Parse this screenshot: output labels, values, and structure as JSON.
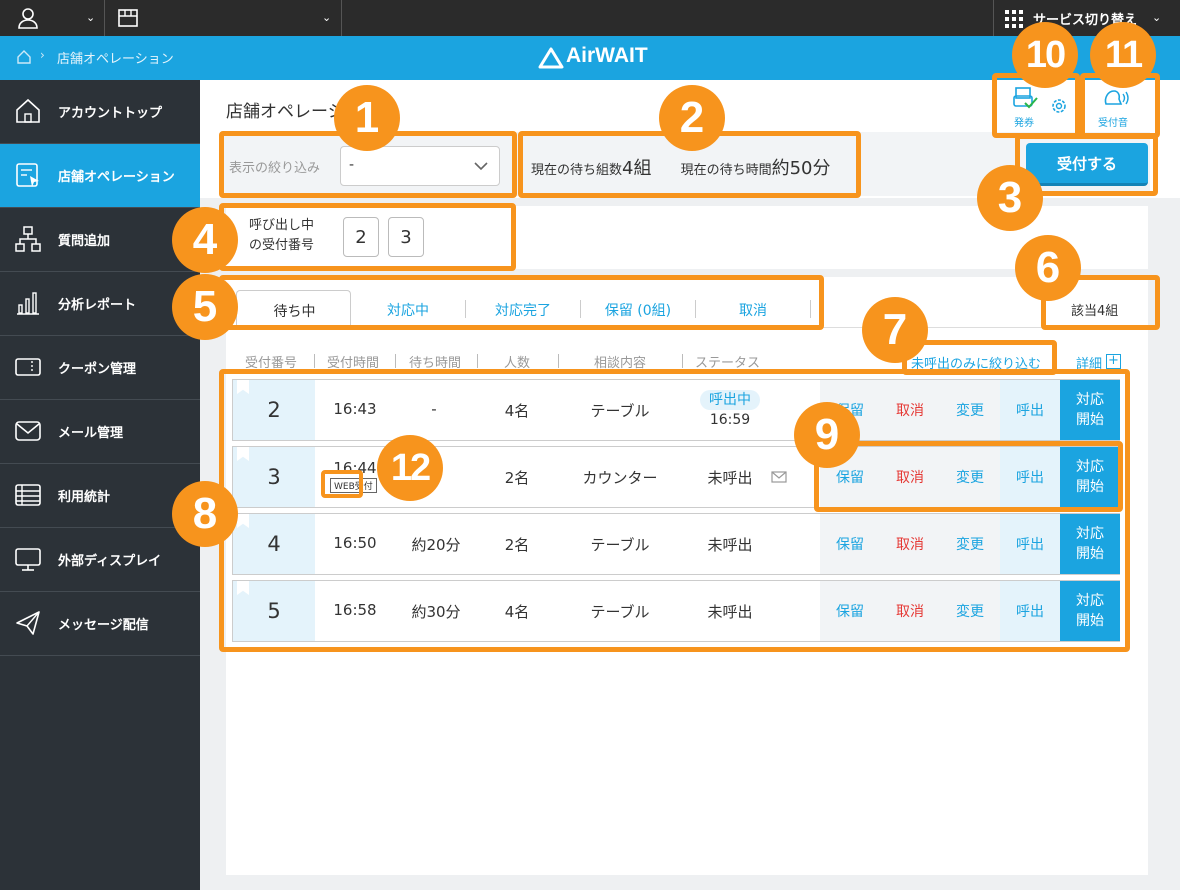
{
  "topbar": {
    "service_switch": "サービス切り替え"
  },
  "header": {
    "breadcrumb": "店舗オペレーション",
    "logo": "AirWAIT"
  },
  "sidebar": {
    "items": [
      {
        "label": "アカウントトップ",
        "icon": "home-icon"
      },
      {
        "label": "店舗オペレーション",
        "icon": "store-operation-icon"
      },
      {
        "label": "質問追加",
        "icon": "hierarchy-icon"
      },
      {
        "label": "分析レポート",
        "icon": "bar-chart-icon"
      },
      {
        "label": "クーポン管理",
        "icon": "coupon-icon"
      },
      {
        "label": "メール管理",
        "icon": "mail-icon"
      },
      {
        "label": "利用統計",
        "icon": "table-icon"
      },
      {
        "label": "外部ディスプレイ",
        "icon": "monitor-icon"
      },
      {
        "label": "メッセージ配信",
        "icon": "paper-plane-icon"
      }
    ]
  },
  "page": {
    "title": "店舗オペレーショ"
  },
  "filter": {
    "label": "表示の絞り込み",
    "value": "-"
  },
  "wait_info": {
    "groups_label": "現在の待ち組数",
    "groups_value": "4組",
    "time_label": "現在の待ち時間",
    "time_value": "約50分"
  },
  "tools": {
    "issue_label": "発券",
    "sound_label": "受付音"
  },
  "accept_button": "受付する",
  "calling": {
    "label_line1": "呼び出し中",
    "label_line2": "の受付番号",
    "numbers": [
      "2",
      "3"
    ]
  },
  "tabs": [
    "待ち中",
    "対応中",
    "対応完了",
    "保留 (0組)",
    "取消"
  ],
  "count": "該当4組",
  "filter_uncalled": "未呼出のみに絞り込む",
  "details": "詳細",
  "columns": [
    "受付番号",
    "受付時間",
    "待ち時間",
    "人数",
    "相談内容",
    "ステータス"
  ],
  "rows": [
    {
      "number": "2",
      "time": "16:43",
      "wait": "-",
      "people": "4名",
      "topic": "テーブル",
      "status": "呼出中",
      "status_time": "16:59"
    },
    {
      "number": "3",
      "time": "16:44",
      "wait": "",
      "people": "2名",
      "topic": "カウンター",
      "status": "未呼出",
      "web_tag": "WEB受付"
    },
    {
      "number": "4",
      "time": "16:50",
      "wait": "約20分",
      "people": "2名",
      "topic": "テーブル",
      "status": "未呼出"
    },
    {
      "number": "5",
      "time": "16:58",
      "wait": "約30分",
      "people": "4名",
      "topic": "テーブル",
      "status": "未呼出"
    }
  ],
  "actions": {
    "hold": "保留",
    "cancel": "取消",
    "change": "変更",
    "call": "呼出",
    "start_line1": "対応",
    "start_line2": "開始"
  },
  "annotations": [
    "1",
    "2",
    "3",
    "4",
    "5",
    "6",
    "7",
    "8",
    "9",
    "10",
    "11",
    "12"
  ],
  "colors": {
    "accent": "#1ba4e0",
    "annotation": "#f7941d",
    "sidebar": "#2c3238",
    "cancel": "#e53935"
  }
}
